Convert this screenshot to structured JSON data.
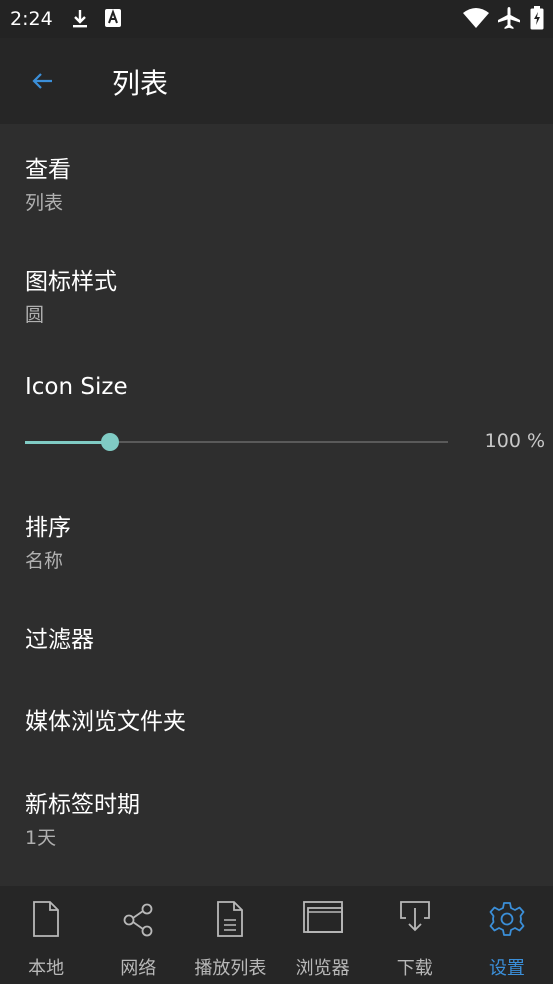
{
  "status_bar": {
    "time": "2:24",
    "icons": [
      "download-icon",
      "a-notification-icon",
      "wifi-icon",
      "airplane-icon",
      "battery-icon"
    ]
  },
  "toolbar": {
    "back_icon": "back-arrow-icon",
    "title": "列表"
  },
  "settings": {
    "view": {
      "title": "查看",
      "value": "列表"
    },
    "icon_style": {
      "title": "图标样式",
      "value": "圆"
    },
    "icon_size": {
      "title": "Icon Size",
      "value_label": "100 %",
      "level_fraction": 0.2
    },
    "sort": {
      "title": "排序",
      "value": "名称"
    },
    "filter": {
      "title": "过滤器"
    },
    "media_folders": {
      "title": "媒体浏览文件夹"
    },
    "new_tag_period": {
      "title": "新标签时期",
      "value": "1天"
    }
  },
  "bottom_nav": {
    "items": [
      {
        "label": "本地",
        "icon": "file-icon"
      },
      {
        "label": "网络",
        "icon": "share-icon"
      },
      {
        "label": "播放列表",
        "icon": "playlist-icon"
      },
      {
        "label": "浏览器",
        "icon": "browser-icon"
      },
      {
        "label": "下载",
        "icon": "download-tray-icon"
      },
      {
        "label": "设置",
        "icon": "gear-icon"
      }
    ],
    "active_index": 5
  },
  "colors": {
    "accent": "#3b8fd9",
    "slider": "#80cbc4",
    "background": "#2e2e2e"
  }
}
